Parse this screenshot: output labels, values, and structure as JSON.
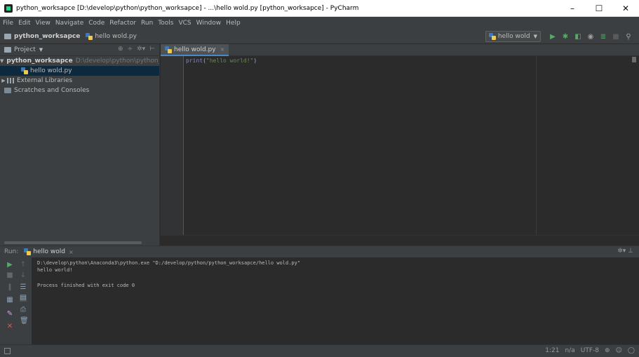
{
  "window": {
    "title": "python_worksapce [D:\\develop\\python\\python_worksapce] - ...\\hello wold.py [python_worksapce] - PyCharm",
    "minimize": "–",
    "maximize": "☐",
    "close": "✕"
  },
  "menu": [
    "File",
    "Edit",
    "View",
    "Navigate",
    "Code",
    "Refactor",
    "Run",
    "Tools",
    "VCS",
    "Window",
    "Help"
  ],
  "navbar": {
    "project": "python_worksapce",
    "file": "hello wold.py",
    "run_config": "hello wold"
  },
  "project_panel": {
    "title": "Project",
    "tree": {
      "root_name": "python_worksapce",
      "root_path": "D:\\develop\\python\\python_wor",
      "file": "hello wold.py",
      "external": "External Libraries",
      "scratches": "Scratches and Consoles"
    }
  },
  "editor": {
    "tab": "hello wold.py",
    "code_fn": "print",
    "code_open": "(",
    "code_str": "\"hello world!\"",
    "code_close": ")"
  },
  "run_panel": {
    "label": "Run:",
    "tab": "hello wold",
    "lines": [
      "D:\\develop\\python\\Anaconda3\\python.exe \"D:/develop/python/python_worksapce/hello wold.py\"",
      "hello world!",
      "Process finished with exit code 0"
    ]
  },
  "statusbar": {
    "position": "1:21",
    "separator": "n/a",
    "encoding": "UTF-8"
  },
  "colors": {
    "background": "#2b2b2b",
    "panel": "#3c3f41",
    "run_green": "#59a869",
    "stop_red": "#e05555"
  }
}
